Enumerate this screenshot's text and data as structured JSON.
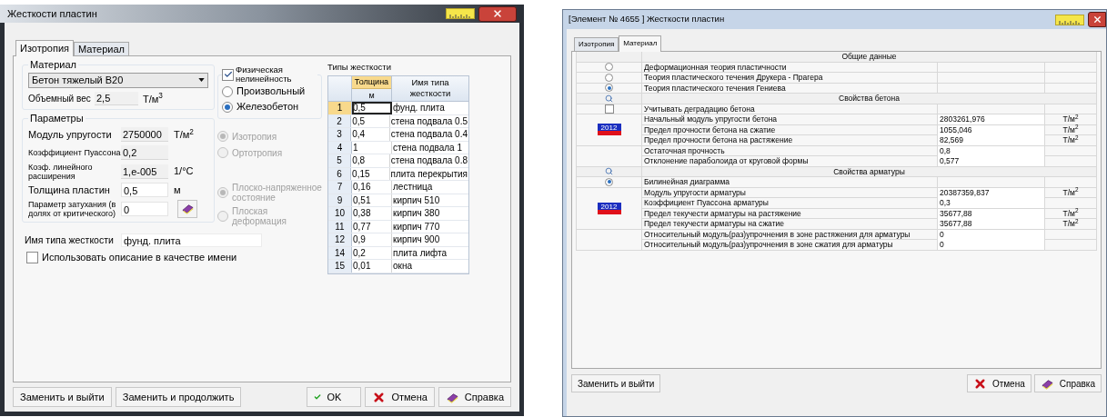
{
  "left_window": {
    "title": "Жесткости пластин",
    "tabs": [
      {
        "label": "Изотропия",
        "selected": true
      },
      {
        "label": "Материал",
        "selected": false
      }
    ],
    "material_group": {
      "title": "Материал",
      "select_value": "Бетон тяжелый В20",
      "weight_label": "Объемный вес",
      "weight_value": "2,5",
      "weight_unit": "Т/м$^{3}$"
    },
    "params_group": {
      "title": "Параметры",
      "fields": [
        {
          "label": "Модуль упругости",
          "value": "2750000",
          "unit": "Т/м$^{2}$",
          "readonly": true,
          "kind": "plain"
        },
        {
          "label": "Коэффициент Пуассона",
          "value": "0,2",
          "readonly": true,
          "kind": "plain"
        },
        {
          "label": "Коэф. линейного расширения",
          "value": "1,е-005",
          "unit": "1/°C",
          "readonly": true,
          "kind": "plain"
        },
        {
          "label": "Толщина пластин",
          "value": "0,5",
          "unit": "м",
          "readonly": false,
          "kind": "plain"
        },
        {
          "label": "Параметр затухания (в долях от критического)",
          "value": "0",
          "readonly": false,
          "kind": "book"
        }
      ]
    },
    "nonlinearity": {
      "label": "Физическая нелинейность",
      "checked": true,
      "options": [
        {
          "label": "Произвольный",
          "selected": false
        },
        {
          "label": "Железобетон",
          "selected": true
        }
      ]
    },
    "anisotropy": [
      {
        "label": "Изотропия",
        "selected": true,
        "disabled": true
      },
      {
        "label": "Ортотропия",
        "selected": false,
        "disabled": true
      }
    ],
    "stress_state": [
      {
        "label": "Плоско-напряженное состояние",
        "selected": true,
        "disabled": true
      },
      {
        "label": "Плоская деформация",
        "selected": false,
        "disabled": true
      }
    ],
    "name_field": {
      "label": "Имя типа жесткости",
      "value": "фунд. плита"
    },
    "use_description": {
      "label": "Использовать описание в качестве имени",
      "checked": false
    },
    "table": {
      "title": "Типы жесткости",
      "columns": [
        {
          "label": "Толщина",
          "sub": "м"
        },
        {
          "label": "Имя типа жесткости"
        }
      ],
      "rows": [
        {
          "number": "1",
          "thickness": "0,5",
          "name": "фунд. плита",
          "selected": true
        },
        {
          "number": "2",
          "thickness": "0,5",
          "name": "стена подвала 0.5",
          "selected": false
        },
        {
          "number": "3",
          "thickness": "0,4",
          "name": "стена подвала 0.4",
          "selected": false
        },
        {
          "number": "4",
          "thickness": "1",
          "name": "стена подвала 1",
          "selected": false
        },
        {
          "number": "5",
          "thickness": "0,8",
          "name": "стена подвала 0.8",
          "selected": false
        },
        {
          "number": "6",
          "thickness": "0,15",
          "name": "плита перекрытия",
          "selected": false
        },
        {
          "number": "7",
          "thickness": "0,16",
          "name": "лестница",
          "selected": false
        },
        {
          "number": "9",
          "thickness": "0,51",
          "name": "кирпич 510",
          "selected": false
        },
        {
          "number": "10",
          "thickness": "0,38",
          "name": "кирпич 380",
          "selected": false
        },
        {
          "number": "11",
          "thickness": "0,77",
          "name": "кирпич 770",
          "selected": false
        },
        {
          "number": "12",
          "thickness": "0,9",
          "name": "кирпич 900",
          "selected": false
        },
        {
          "number": "14",
          "thickness": "0,2",
          "name": "плита лифта",
          "selected": false
        },
        {
          "number": "15",
          "thickness": "0,01",
          "name": "окна",
          "selected": false
        }
      ]
    },
    "buttons_left": [
      {
        "label": "Заменить и выйти"
      },
      {
        "label": "Заменить и продолжить"
      }
    ],
    "buttons_right": [
      {
        "label": "OK",
        "kind": "ok"
      },
      {
        "label": "Отмена",
        "kind": "cancel"
      },
      {
        "label": "Справка",
        "kind": "help"
      }
    ]
  },
  "right_window": {
    "title": "[Элемент № 4655 ] Жесткости пластин",
    "tabs": [
      {
        "label": "Изотропия",
        "selected": false
      },
      {
        "label": "Материал",
        "selected": true
      }
    ],
    "rows": [
      {
        "kind": "section",
        "label": "Общие данные"
      },
      {
        "kind": "radio",
        "label": "Деформационная теория пластичности",
        "selected": false
      },
      {
        "kind": "radio",
        "label": "Теория пластического течения Друкера - Прагера",
        "selected": false
      },
      {
        "kind": "radio",
        "label": "Теория пластического течения Гениева",
        "selected": true
      },
      {
        "kind": "section",
        "label": "Свойства бетона",
        "search_icon": true
      },
      {
        "kind": "check",
        "label": "Учитывать деградацию бетона",
        "checked": false
      },
      {
        "kind": "group",
        "badge": "2012",
        "items": [
          {
            "label": "Начальный модуль упругости бетона",
            "value": "2803261,976",
            "unit": "Т/м$^{2}$"
          },
          {
            "label": "Предел прочности бетона на сжатие",
            "value": "1055,046",
            "unit": "Т/м$^{2}$"
          },
          {
            "label": "Предел прочности бетона на растяжение",
            "value": "82,569",
            "unit": "Т/м$^{2}$"
          }
        ]
      },
      {
        "kind": "group",
        "items": [
          {
            "label": "Остаточная прочность",
            "value": "0,8"
          },
          {
            "label": "Отклонение параболоида от круговой формы",
            "value": "0,577"
          }
        ]
      },
      {
        "kind": "section",
        "label": "Свойства арматуры",
        "search_icon": true
      },
      {
        "kind": "radio",
        "label": "Билинейная диаграмма",
        "selected": true
      },
      {
        "kind": "group",
        "badge": "2012",
        "items": [
          {
            "label": "Модуль упругости арматуры",
            "value": "20387359,837",
            "unit": "Т/м$^{2}$"
          },
          {
            "label": "Коэффициент Пуассона арматуры",
            "value": "0,3"
          },
          {
            "label": "Предел текучести арматуры на растяжение",
            "value": "35677,88",
            "unit": "Т/м$^{2}$"
          },
          {
            "label": "Предел текучести арматуры на сжатие",
            "value": "35677,88",
            "unit": "Т/м$^{2}$"
          }
        ]
      },
      {
        "kind": "group",
        "items": [
          {
            "label": "Относительный модуль(раз)упрочнения в зоне растяжения для арматуры",
            "value": "0"
          },
          {
            "label": "Относительный модуль(раз)упрочнения в зоне сжатия для арматуры",
            "value": "0"
          }
        ]
      }
    ],
    "buttons_left": [
      {
        "label": "Заменить и выйти"
      }
    ],
    "buttons_right": [
      {
        "label": "Отмена",
        "kind": "cancel"
      },
      {
        "label": "Справка",
        "kind": "help"
      }
    ]
  }
}
